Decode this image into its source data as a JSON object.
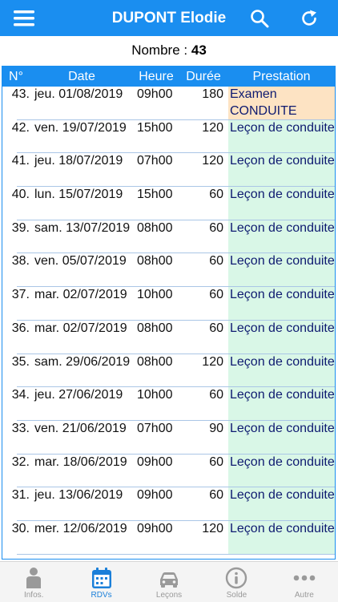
{
  "header": {
    "title": "DUPONT Elodie",
    "menu_icon": "hamburger-menu-icon",
    "search_icon": "search-icon",
    "refresh_icon": "refresh-icon"
  },
  "summary": {
    "label": "Nombre :",
    "count": "43"
  },
  "table": {
    "columns": [
      "N°",
      "Date",
      "Heure",
      "Durée",
      "Prestation"
    ],
    "rows": [
      {
        "num": "43.",
        "date": "jeu. 01/08/2019",
        "heure": "09h00",
        "duree": "180",
        "prestation": "Examen CONDUITE",
        "kind": "exam"
      },
      {
        "num": "42.",
        "date": "ven. 19/07/2019",
        "heure": "15h00",
        "duree": "120",
        "prestation": "Leçon de conduite",
        "kind": "lesson"
      },
      {
        "num": "41.",
        "date": "jeu. 18/07/2019",
        "heure": "07h00",
        "duree": "120",
        "prestation": "Leçon de conduite",
        "kind": "lesson"
      },
      {
        "num": "40.",
        "date": "lun. 15/07/2019",
        "heure": "15h00",
        "duree": "60",
        "prestation": "Leçon de conduite",
        "kind": "lesson"
      },
      {
        "num": "39.",
        "date": "sam. 13/07/2019",
        "heure": "08h00",
        "duree": "60",
        "prestation": "Leçon de conduite",
        "kind": "lesson"
      },
      {
        "num": "38.",
        "date": "ven. 05/07/2019",
        "heure": "08h00",
        "duree": "60",
        "prestation": "Leçon de conduite",
        "kind": "lesson"
      },
      {
        "num": "37.",
        "date": "mar. 02/07/2019",
        "heure": "10h00",
        "duree": "60",
        "prestation": "Leçon de conduite",
        "kind": "lesson"
      },
      {
        "num": "36.",
        "date": "mar. 02/07/2019",
        "heure": "08h00",
        "duree": "60",
        "prestation": "Leçon de conduite",
        "kind": "lesson"
      },
      {
        "num": "35.",
        "date": "sam. 29/06/2019",
        "heure": "08h00",
        "duree": "120",
        "prestation": "Leçon de conduite",
        "kind": "lesson"
      },
      {
        "num": "34.",
        "date": "jeu. 27/06/2019",
        "heure": "10h00",
        "duree": "60",
        "prestation": "Leçon de conduite",
        "kind": "lesson"
      },
      {
        "num": "33.",
        "date": "ven. 21/06/2019",
        "heure": "07h00",
        "duree": "90",
        "prestation": "Leçon de conduite",
        "kind": "lesson"
      },
      {
        "num": "32.",
        "date": "mar. 18/06/2019",
        "heure": "09h00",
        "duree": "60",
        "prestation": "Leçon de conduite",
        "kind": "lesson"
      },
      {
        "num": "31.",
        "date": "jeu. 13/06/2019",
        "heure": "09h00",
        "duree": "60",
        "prestation": "Leçon de conduite",
        "kind": "lesson"
      },
      {
        "num": "30.",
        "date": "mer. 12/06/2019",
        "heure": "09h00",
        "duree": "120",
        "prestation": "Leçon de conduite",
        "kind": "lesson"
      }
    ]
  },
  "tabs": [
    {
      "label": "Infos.",
      "icon": "person-icon",
      "active": false
    },
    {
      "label": "RDVs",
      "icon": "calendar-icon",
      "active": true
    },
    {
      "label": "Leçons",
      "icon": "car-icon",
      "active": false
    },
    {
      "label": "Solde",
      "icon": "info-icon",
      "active": false
    },
    {
      "label": "Autre",
      "icon": "more-dots-icon",
      "active": false
    }
  ],
  "colors": {
    "primary": "#1a8ef0",
    "lesson_bg": "#d9f7e7",
    "exam_bg": "#fde3c3",
    "text_dark_blue": "#0e1a70",
    "tab_inactive": "#999999",
    "tab_active": "#1a7fd9"
  }
}
